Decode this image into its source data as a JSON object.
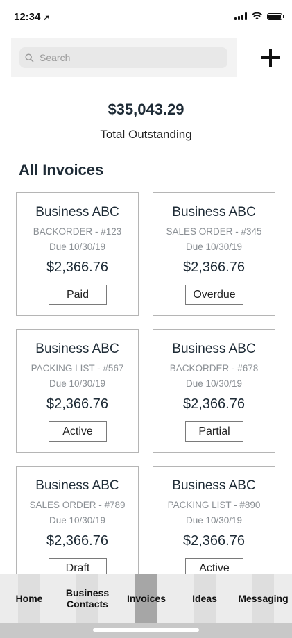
{
  "status_bar": {
    "time": "12:34"
  },
  "search": {
    "placeholder": "Search"
  },
  "summary": {
    "total_amount": "$35,043.29",
    "total_label": "Total Outstanding"
  },
  "section": {
    "title": "All Invoices"
  },
  "invoices": [
    {
      "business": "Business ABC",
      "document": "BACKORDER - #123",
      "due": "Due 10/30/19",
      "amount": "$2,366.76",
      "status": "Paid"
    },
    {
      "business": "Business ABC",
      "document": "SALES ORDER - #345",
      "due": "Due 10/30/19",
      "amount": "$2,366.76",
      "status": "Overdue"
    },
    {
      "business": "Business ABC",
      "document": "PACKING LIST - #567",
      "due": "Due 10/30/19",
      "amount": "$2,366.76",
      "status": "Active"
    },
    {
      "business": "Business ABC",
      "document": "BACKORDER - #678",
      "due": "Due 10/30/19",
      "amount": "$2,366.76",
      "status": "Partial"
    },
    {
      "business": "Business ABC",
      "document": "SALES ORDER - #789",
      "due": "Due 10/30/19",
      "amount": "$2,366.76",
      "status": "Draft"
    },
    {
      "business": "Business ABC",
      "document": "PACKING LIST - #890",
      "due": "Due 10/30/19",
      "amount": "$2,366.76",
      "status": "Active"
    }
  ],
  "nav": {
    "active": "Invoices",
    "items": [
      {
        "label": "Home"
      },
      {
        "label": "Business\nContacts"
      },
      {
        "label": "Invoices"
      },
      {
        "label": "Ideas"
      },
      {
        "label": "Messaging"
      }
    ]
  },
  "icons": {
    "status_bar": [
      "location-arrow-icon",
      "signal-bars-icon",
      "wifi-icon",
      "battery-icon"
    ],
    "search": "search-icon",
    "add": "plus-icon"
  },
  "colors": {
    "text_dark": "#1e2b36",
    "muted": "#8a8f94",
    "nav_bg": "#ececec",
    "nav_active": "#a6a6a6"
  }
}
